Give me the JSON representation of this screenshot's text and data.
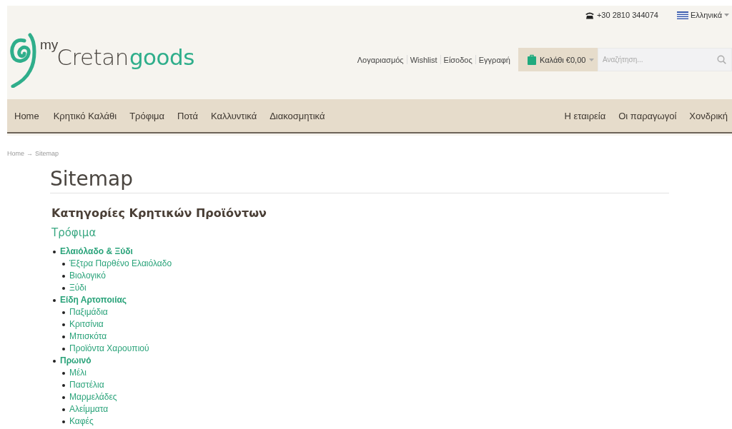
{
  "topbar": {
    "phone": "+30 2810 344074",
    "language": "Ελληνικά"
  },
  "logo": {
    "small": "my",
    "main": "Cretan",
    "accent": "goods"
  },
  "account_links": [
    "Λογαριασμός",
    "Wishlist",
    "Είσοδος",
    "Εγγραφή"
  ],
  "cart": {
    "label": "Καλάθι €0,00"
  },
  "search": {
    "placeholder": "Αναζήτηση..."
  },
  "nav_left": [
    "Home",
    "Κρητικό Καλάθι",
    "Τρόφιμα",
    "Ποτά",
    "Καλλυντικά",
    "Διακοσμητικά"
  ],
  "nav_right": [
    "Η εταιρεία",
    "Οι παραγωγοί",
    "Χονδρική"
  ],
  "breadcrumb": {
    "home": "Home",
    "separator": "→",
    "current": "Sitemap"
  },
  "page_title": "Sitemap",
  "section_title": "Κατηγορίες Κρητικών Προϊόντων",
  "category": "Τρόφιμα",
  "tree": [
    {
      "label": "Ελαιόλαδο & Ξύδι",
      "children": [
        {
          "label": "Έξτρα Παρθένο Ελαιόλαδο"
        },
        {
          "label": "Βιολογικό"
        },
        {
          "label": "Ξύδι"
        }
      ]
    },
    {
      "label": "Είδη Αρτοποιίας",
      "children": [
        {
          "label": "Παξιμάδια"
        },
        {
          "label": "Κριτσίνια"
        },
        {
          "label": "Μπισκότα"
        },
        {
          "label": "Προϊόντα Χαρουπιού"
        }
      ]
    },
    {
      "label": "Πρωινό",
      "children": [
        {
          "label": "Μέλι"
        },
        {
          "label": "Παστέλια"
        },
        {
          "label": "Μαρμελάδες"
        },
        {
          "label": "Αλείμματα"
        },
        {
          "label": "Καφές"
        }
      ]
    }
  ]
}
